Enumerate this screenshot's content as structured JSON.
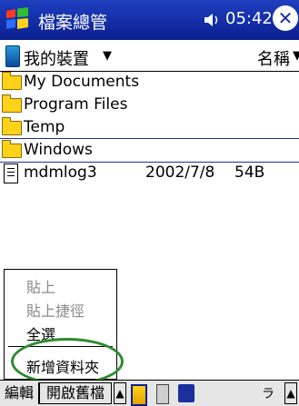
{
  "titlebar": {
    "title": "檔案總管",
    "time": "05:42",
    "close": "✕"
  },
  "location": {
    "label": "我的裝置",
    "caret": "▼",
    "sort": "名稱",
    "sort_caret": "▼"
  },
  "files": [
    {
      "name": "My Documents",
      "type": "folder"
    },
    {
      "name": "Program Files",
      "type": "folder"
    },
    {
      "name": "Temp",
      "type": "folder"
    },
    {
      "name": "Windows",
      "type": "folder",
      "selected": true
    },
    {
      "name": "mdmlog3",
      "type": "file",
      "date": "2002/7/8",
      "size": "54B"
    }
  ],
  "menu": {
    "paste": "貼上",
    "paste_shortcut": "貼上捷徑",
    "select_all": "全選",
    "new_folder": "新增資料夾"
  },
  "bottombar": {
    "edit": "編輯",
    "open": "開啟舊檔",
    "up": "▲",
    "kb": "ラ"
  },
  "colors": {
    "titlebar": "#1b2f9e",
    "highlight": "#2e8b2e",
    "folder": "#ffd21a"
  },
  "icons": [
    "windows-flag-icon",
    "speaker-icon",
    "close-icon",
    "device-icon",
    "folder-icon",
    "document-icon"
  ]
}
